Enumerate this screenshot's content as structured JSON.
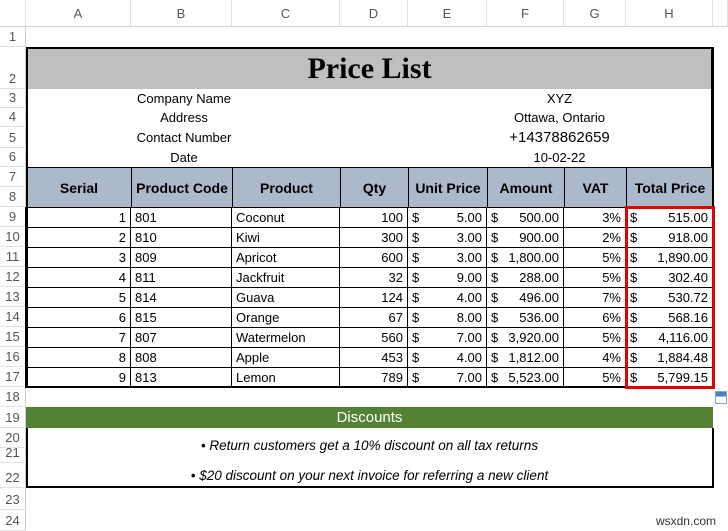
{
  "columns": [
    "A",
    "B",
    "C",
    "D",
    "E",
    "F",
    "G",
    "H"
  ],
  "rows": [
    "1",
    "2",
    "3",
    "4",
    "5",
    "6",
    "7",
    "8",
    "9",
    "10",
    "11",
    "12",
    "13",
    "14",
    "15",
    "16",
    "17",
    "18",
    "19",
    "20",
    "21",
    "22",
    "23",
    "24"
  ],
  "title": "Price List",
  "info": [
    {
      "label": "Company Name",
      "value": "XYZ"
    },
    {
      "label": "Address",
      "value": "Ottawa, Ontario"
    },
    {
      "label": "Contact Number",
      "value": "+14378862659"
    },
    {
      "label": "Date",
      "value": "10-02-22"
    }
  ],
  "headers": [
    "Serial",
    "Product Code",
    "Product",
    "Qty",
    "Unit Price",
    "Amount",
    "VAT",
    "Total Price"
  ],
  "currency": "$",
  "items": [
    [
      "1",
      "801",
      "Coconut",
      "100",
      "5.00",
      "500.00",
      "3%",
      "515.00"
    ],
    [
      "2",
      "810",
      "Kiwi",
      "300",
      "3.00",
      "900.00",
      "2%",
      "918.00"
    ],
    [
      "3",
      "809",
      "Apricot",
      "600",
      "3.00",
      "1,800.00",
      "5%",
      "1,890.00"
    ],
    [
      "4",
      "811",
      "Jackfruit",
      "32",
      "9.00",
      "288.00",
      "5%",
      "302.40"
    ],
    [
      "5",
      "814",
      "Guava",
      "124",
      "4.00",
      "496.00",
      "7%",
      "530.72"
    ],
    [
      "6",
      "815",
      "Orange",
      "67",
      "8.00",
      "536.00",
      "6%",
      "568.16"
    ],
    [
      "7",
      "807",
      "Watermelon",
      "560",
      "7.00",
      "3,920.00",
      "5%",
      "4,116.00"
    ],
    [
      "8",
      "808",
      "Apple",
      "453",
      "4.00",
      "1,812.00",
      "4%",
      "1,884.48"
    ],
    [
      "9",
      "813",
      "Lemon",
      "789",
      "7.00",
      "5,523.00",
      "5%",
      "5,799.15"
    ]
  ],
  "discounts": {
    "title": "Discounts",
    "lines": [
      "• Return customers get a 10% discount on all tax returns",
      "• $20 discount on your next invoice for referring a new client"
    ]
  },
  "watermark": "wsxdn.com",
  "colors": {
    "title_bg": "#bfbfbf",
    "header_bg": "#acb9ca",
    "discount_bg": "#548235",
    "highlight": "#e00000"
  }
}
